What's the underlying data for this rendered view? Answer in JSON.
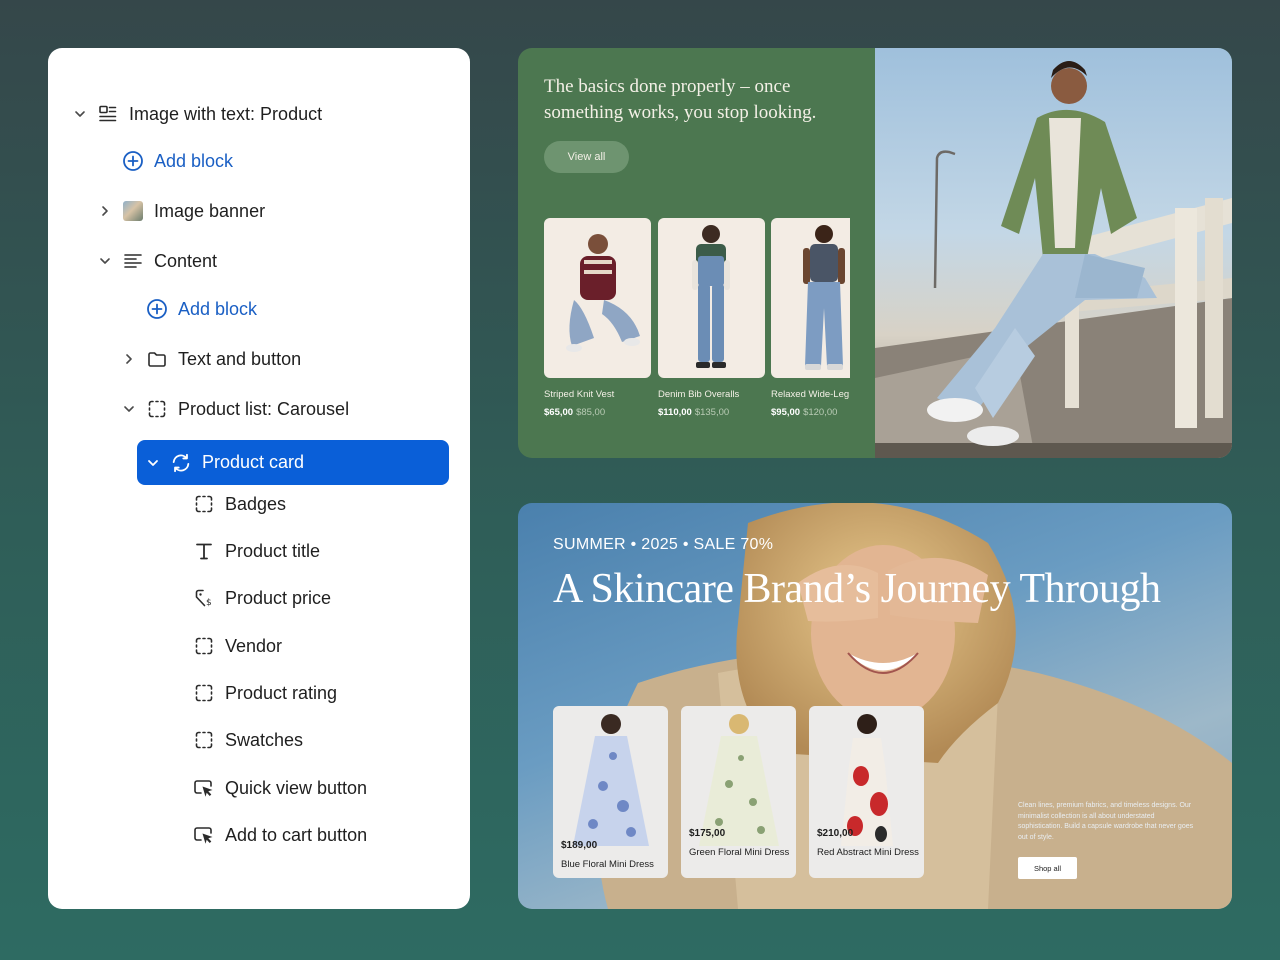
{
  "tree": {
    "items": [
      {
        "label": "Image with text: Product",
        "icon": "section-layout-icon"
      },
      {
        "label": "Add block",
        "icon": "plus-circle-icon"
      },
      {
        "label": "Image banner",
        "icon": "image-thumbnail-icon"
      },
      {
        "label": "Content",
        "icon": "text-lines-icon"
      },
      {
        "label": "Add block",
        "icon": "plus-circle-icon"
      },
      {
        "label": "Text and button",
        "icon": "folder-icon"
      },
      {
        "label": "Product list: Carousel",
        "icon": "dashed-square-icon"
      },
      {
        "label": "Product card",
        "icon": "refresh-icon"
      },
      {
        "label": "Badges",
        "icon": "dashed-square-icon"
      },
      {
        "label": "Product title",
        "icon": "text-t-icon"
      },
      {
        "label": "Product price",
        "icon": "price-tag-icon"
      },
      {
        "label": "Vendor",
        "icon": "dashed-square-icon"
      },
      {
        "label": "Product rating",
        "icon": "dashed-square-icon"
      },
      {
        "label": "Swatches",
        "icon": "dashed-square-icon"
      },
      {
        "label": "Quick view button",
        "icon": "cursor-click-icon"
      },
      {
        "label": "Add to cart button",
        "icon": "cursor-click-icon"
      }
    ]
  },
  "colors": {
    "accent": "#0a5fd8",
    "link": "#1a5fc4",
    "card1_bg": "#4c7750"
  },
  "card1": {
    "headline": "The basics done properly – once something works, you stop looking.",
    "button": "View all",
    "products": [
      {
        "name": "Striped Knit Vest",
        "price": "$65,00",
        "was": "$85,00"
      },
      {
        "name": "Denim Bib Overalls",
        "price": "$110,00",
        "was": "$135,00"
      },
      {
        "name": "Relaxed Wide-Leg",
        "price": "$95,00",
        "was": "$120,00"
      }
    ]
  },
  "card2": {
    "tag": "SUMMER • 2025 • SALE 70%",
    "title": "A Skincare Brand’s Journey Through",
    "products": [
      {
        "price": "$189,00",
        "name": "Blue Floral Mini Dress"
      },
      {
        "price": "$175,00",
        "name": "Green Floral Mini Dress"
      },
      {
        "price": "$210,00",
        "name": "Red Abstract Mini Dress"
      }
    ],
    "blurb": "Clean lines, premium fabrics, and timeless designs. Our minimalist collection is all about understated sophistication. Build a capsule wardrobe that never goes out of style.",
    "button": "Shop all"
  }
}
